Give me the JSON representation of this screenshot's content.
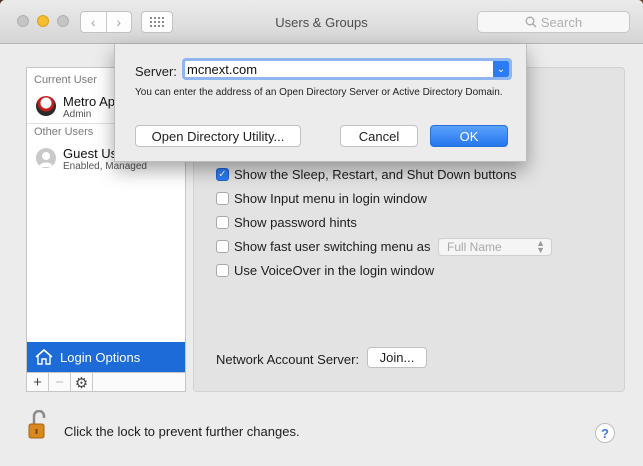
{
  "window": {
    "title": "Users & Groups"
  },
  "toolbar": {
    "search_placeholder": "Search"
  },
  "sidebar": {
    "current_user_label": "Current User",
    "current_user": {
      "name": "Metro Ap",
      "role": "Admin"
    },
    "other_users_label": "Other Users",
    "guest_user": {
      "name": "Guest Us",
      "status": "Enabled, Managed"
    },
    "login_options_label": "Login Options",
    "add_label": "+",
    "remove_label": "−"
  },
  "panel": {
    "options": [
      {
        "label": "Show the Sleep, Restart, and Shut Down buttons",
        "checked": true
      },
      {
        "label": "Show Input menu in login window",
        "checked": false
      },
      {
        "label": "Show password hints",
        "checked": false
      },
      {
        "label": "Show fast user switching menu as",
        "checked": false
      },
      {
        "label": "Use VoiceOver in the login window",
        "checked": false
      }
    ],
    "fast_switch_value": "Full Name",
    "network_label": "Network Account Server:",
    "join_label": "Join..."
  },
  "footer": {
    "lock_label": "Click the lock to prevent further changes.",
    "help_label": "?"
  },
  "sheet": {
    "server_label": "Server:",
    "server_value": "mcnext.com",
    "help_text": "You can enter the address of an Open Directory Server or Active Directory Domain.",
    "odu_label": "Open Directory Utility...",
    "cancel_label": "Cancel",
    "ok_label": "OK"
  },
  "colors": {
    "accent": "#2d7bf4",
    "selection": "#1c6bd6",
    "minimize": "#f5bd2f"
  }
}
